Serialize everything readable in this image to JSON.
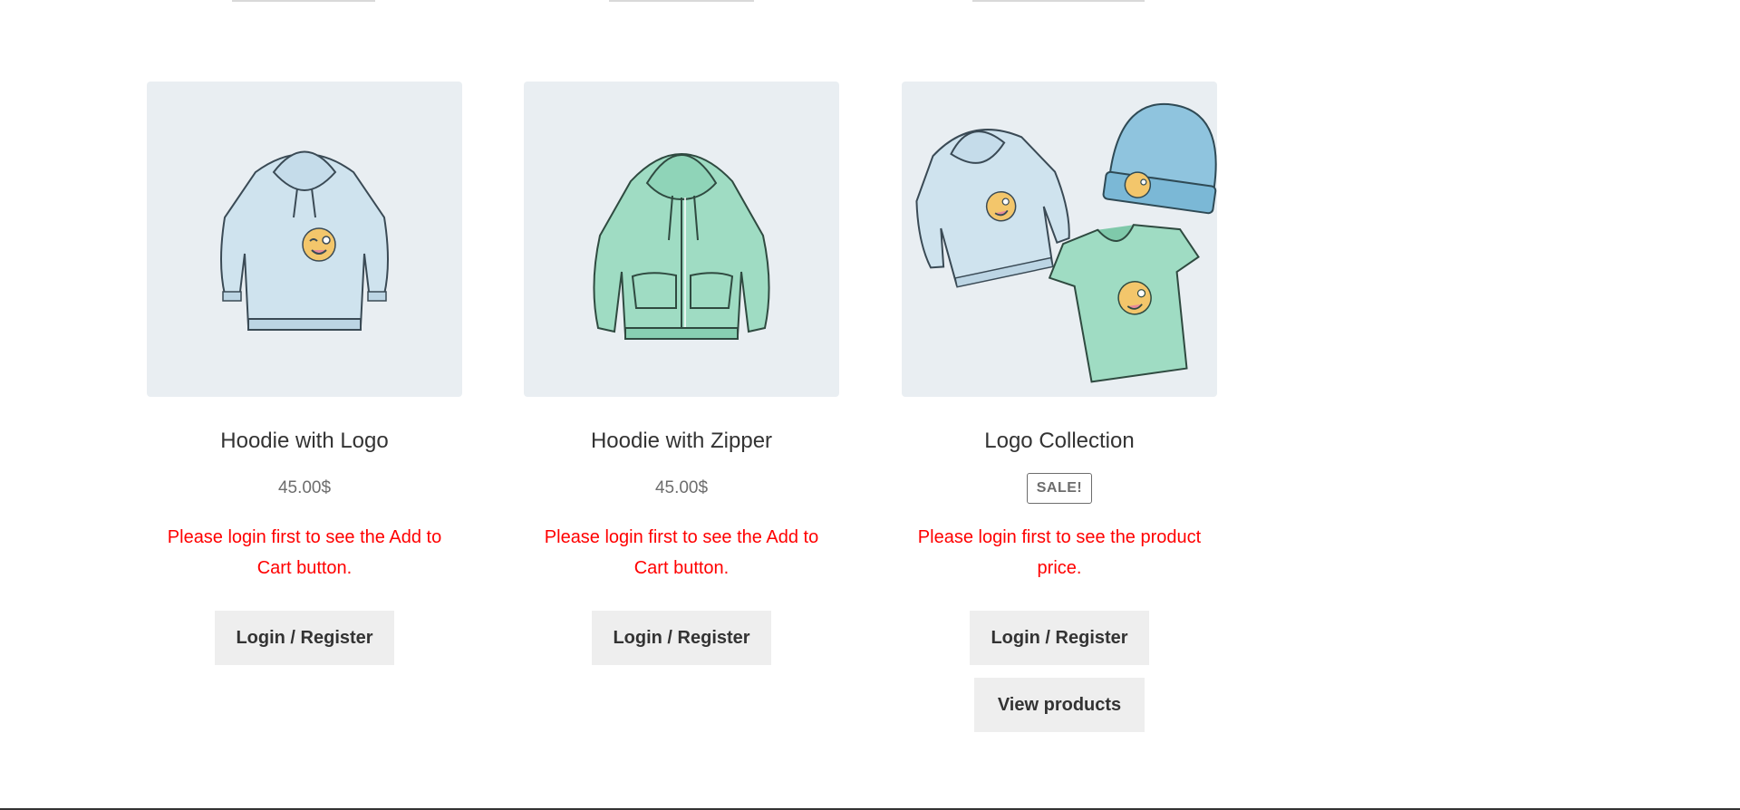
{
  "products": [
    {
      "title": "Hoodie with Logo",
      "price": "45.00$",
      "notice": "Please login first to see the Add to Cart button.",
      "login_label": "Login / Register",
      "image_icon": "hoodie-with-logo-image"
    },
    {
      "title": "Hoodie with Zipper",
      "price": "45.00$",
      "notice": "Please login first to see the Add to Cart button.",
      "login_label": "Login / Register",
      "image_icon": "hoodie-with-zipper-image"
    },
    {
      "title": "Logo Collection",
      "badge": "SALE!",
      "notice": "Please login first to see the product price.",
      "login_label": "Login / Register",
      "view_label": "View products",
      "image_icon": "logo-collection-image"
    }
  ],
  "colors": {
    "notice": "#ff0000",
    "button_bg": "#eeeeee",
    "thumb_bg": "#e9eef2",
    "text": "#333333",
    "price": "#6d6d6d"
  }
}
